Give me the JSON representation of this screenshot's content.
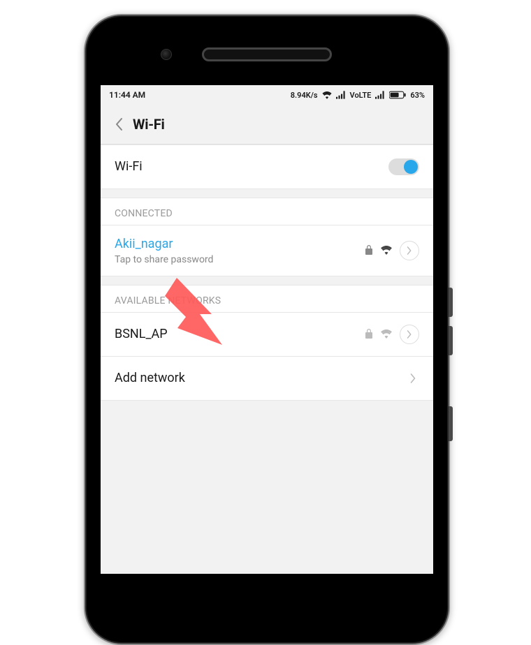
{
  "status": {
    "time": "11:44 AM",
    "throughput": "8.94K/s",
    "volte": "VoLTE",
    "battery_pct": "63%"
  },
  "header": {
    "title": "Wi-Fi"
  },
  "wifi_toggle": {
    "label": "Wi-Fi",
    "on": true
  },
  "connected": {
    "header": "CONNECTED",
    "network": {
      "name": "Akii_nagar",
      "subtitle": "Tap to share password"
    }
  },
  "available": {
    "header": "AVAILABLE NETWORKS",
    "networks": [
      {
        "name": "BSNL_AP"
      }
    ],
    "add_network_label": "Add network"
  },
  "colors": {
    "accent": "#28a7ea",
    "text": "#1a1a1a",
    "muted": "#9a9a9a",
    "divider": "#e6e6e6"
  }
}
